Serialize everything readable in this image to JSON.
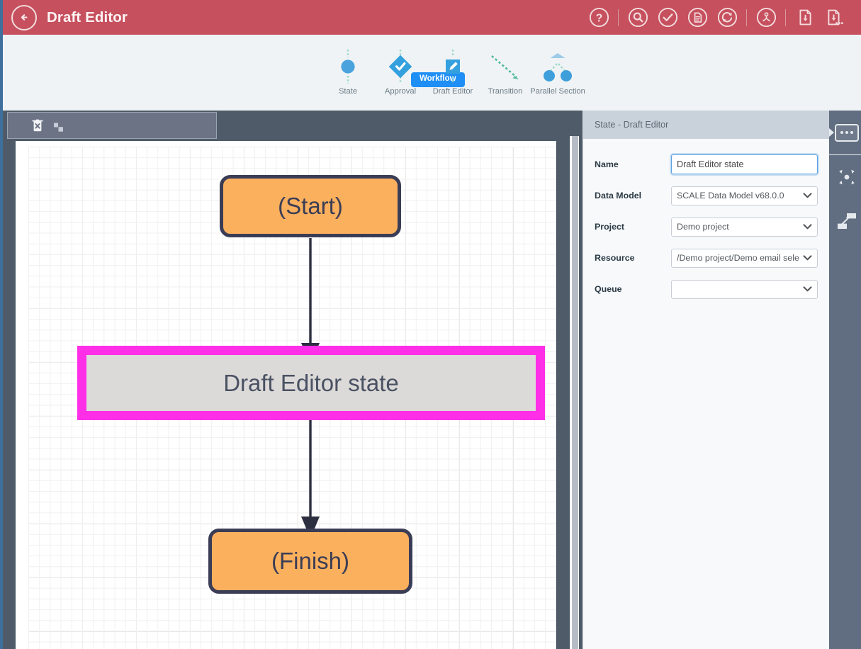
{
  "window": {
    "accent_red": "#c6505e",
    "accent_blue": "#1f8ff5",
    "selection_magenta": "#ff2fe8",
    "node_orange": "#fbb05e",
    "node_border": "#3a3d55"
  },
  "header": {
    "title": "Draft Editor",
    "back_icon": "arrow-left-circle-icon",
    "tools": [
      {
        "name": "help-icon",
        "label": "Help"
      },
      {
        "name": "separator",
        "label": ""
      },
      {
        "name": "search-icon",
        "label": "Search"
      },
      {
        "name": "validate-check-icon",
        "label": "Validate"
      },
      {
        "name": "document-icon",
        "label": "Document"
      },
      {
        "name": "refresh-icon",
        "label": "Refresh"
      },
      {
        "name": "separator",
        "label": ""
      },
      {
        "name": "assign-user-icon",
        "label": "Assign"
      },
      {
        "name": "separator",
        "label": ""
      },
      {
        "name": "import-document-icon",
        "label": "Import"
      },
      {
        "name": "import-document-options-icon",
        "label": "Import options"
      }
    ]
  },
  "ribbon": {
    "active_tab": "Workflow",
    "palette": [
      {
        "label": "State",
        "icon": "state-circle-icon"
      },
      {
        "label": "Approval",
        "icon": "approval-diamond-check-icon"
      },
      {
        "label": "Draft Editor",
        "icon": "draft-editor-pencil-icon"
      },
      {
        "label": "Transition",
        "icon": "transition-arrow-icon"
      },
      {
        "label": "Parallel Section",
        "icon": "parallel-section-icon"
      }
    ]
  },
  "canvas": {
    "toolbar": [
      {
        "name": "delete-icon",
        "label": "Delete"
      },
      {
        "name": "align-squares-icon",
        "label": "Align"
      }
    ],
    "nodes": [
      {
        "id": "start",
        "label": "(Start)",
        "type": "terminal",
        "selected": false
      },
      {
        "id": "draft-editor-state",
        "label": "Draft Editor state",
        "type": "state",
        "selected": true
      },
      {
        "id": "finish",
        "label": "(Finish)",
        "type": "terminal",
        "selected": false
      }
    ],
    "connectors": [
      {
        "from": "start",
        "to": "draft-editor-state"
      },
      {
        "from": "draft-editor-state",
        "to": "finish"
      }
    ]
  },
  "panel": {
    "title": "State - Draft Editor",
    "fields": [
      {
        "label": "Name",
        "control": "text",
        "value": "Draft Editor state",
        "placeholder": "",
        "focused": true
      },
      {
        "label": "Data Model",
        "control": "select",
        "value": "SCALE Data Model v68.0.0"
      },
      {
        "label": "Project",
        "control": "select",
        "value": "Demo project"
      },
      {
        "label": "Resource",
        "control": "select",
        "value": "/Demo project/Demo email sele"
      },
      {
        "label": "Queue",
        "control": "select",
        "value": ""
      }
    ]
  },
  "strip": {
    "buttons": [
      {
        "name": "properties-panel-toggle-icon",
        "label": "Properties"
      },
      {
        "name": "fit-to-screen-icon",
        "label": "Fit to screen"
      },
      {
        "name": "auto-layout-icon",
        "label": "Auto layout"
      }
    ]
  }
}
